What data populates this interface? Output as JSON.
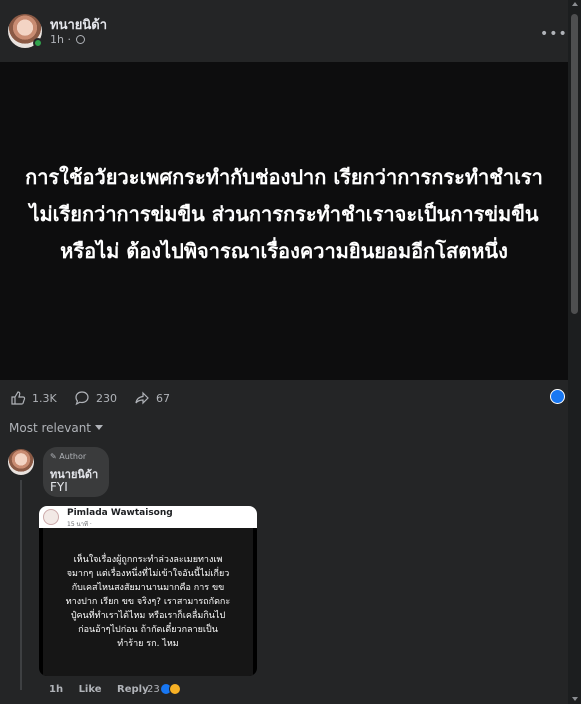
{
  "post": {
    "author": "ทนายนิด้า",
    "time": "1h",
    "privacy_icon": "globe-icon",
    "more_icon": "more-horizontal-icon",
    "text": "การใช้อวัยวะเพศกระทำกับช่องปาก เรียกว่าการกระทำชำเรา ไม่เรียกว่าการข่มขืน ส่วนการกระทำชำเราจะเป็นการข่มขืนหรือไม่ ต้องไปพิจารณาเรื่องความยินยอมอีกโสตหนึ่ง"
  },
  "stats": {
    "likes": "1.3K",
    "comments": "230",
    "shares": "67"
  },
  "comments_section": {
    "sort_label": "Most relevant"
  },
  "comment": {
    "badge": "Author",
    "name": "ทนายนิด้า",
    "text": "FYI",
    "time": "1h",
    "like_label": "Like",
    "reply_label": "Reply",
    "reaction_count": "23"
  },
  "screenshot_card": {
    "name": "Pimlada Wawtaisong",
    "time": "15 นาที ·",
    "text": "เห็นใจเรื่องผู้ถูกกระทำล่วงละเมยทางเพจมากๆ แต่เรื่องหนึ่งที่ไม่เข้าใจอันนี้ไม่เกี่ยวกับเคสไหนสงสัยมานานมากคือ การ ขข ทางปาก เรียก ขข จริงๆ? เราสามารถกัดกะปู๋คนที่ทำเราได้ไหม หรือเราก็เคลื่มกินไปก่อนอ้าๆไปก่อน ถ้ากัดเดี๋ยวกลายเป็นทำร้าย รก. ไหม"
  },
  "colors": {
    "accent": "#1877f2",
    "online": "#31a24c",
    "background": "#242526"
  }
}
